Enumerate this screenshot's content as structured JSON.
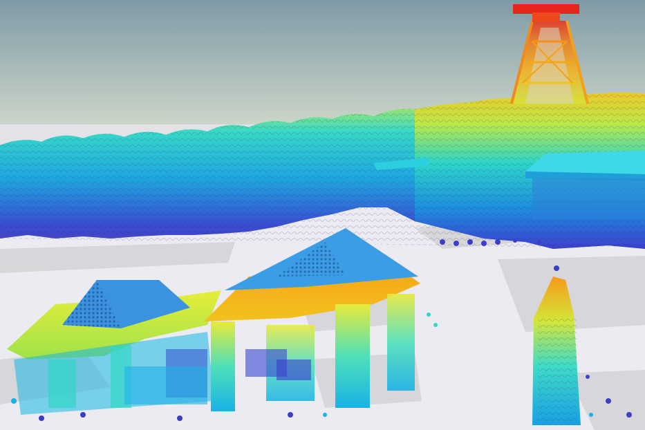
{
  "scene": {
    "kind": "lidar-point-cloud-3d-view",
    "color_scale": "height-elevation",
    "palette": {
      "low": "#3a3fd0",
      "mid_low": "#18b2e6",
      "mid": "#2fe0c8",
      "mid_high": "#d9ec3a",
      "high": "#f3a21a",
      "top": "#e82a1c"
    },
    "sky": {
      "top": "#7f9aa6",
      "horizon": "#d4dccd"
    },
    "ground": "#ecebf1",
    "objects": [
      {
        "name": "headframe-tower",
        "color_band": "orange-red"
      },
      {
        "name": "tree-line",
        "color_band": "blue-to-yellow"
      },
      {
        "name": "hall-building",
        "color_band": "cyan"
      },
      {
        "name": "left-pavilion",
        "color_band": "yellow-blue"
      },
      {
        "name": "center-pavilion",
        "color_band": "orange-yellow"
      },
      {
        "name": "right-column",
        "color_band": "cyan-orange"
      }
    ]
  }
}
